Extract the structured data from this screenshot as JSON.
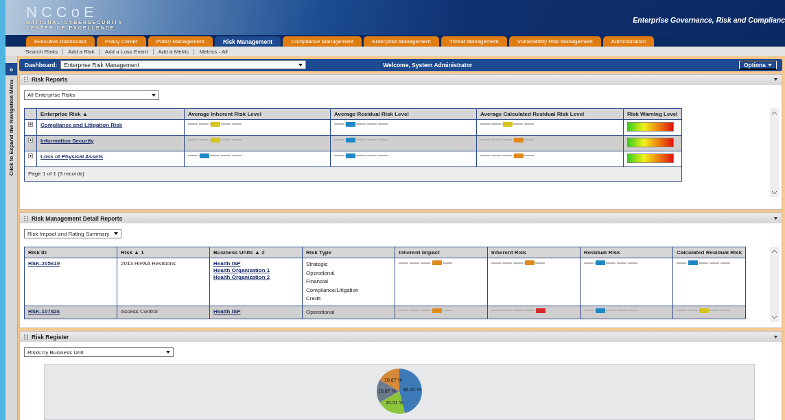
{
  "header": {
    "logo_mark": "NCCoE",
    "logo_line_1": "NATIONAL CYBERSECURITY",
    "logo_line_2": "CENTER OF EXCELLENCE",
    "tagline": "Enterprise Governance, Risk and Complianc"
  },
  "tabs": [
    {
      "label": "Executive Dashboard",
      "selected": false
    },
    {
      "label": "Policy Center",
      "selected": false
    },
    {
      "label": "Policy Management",
      "selected": false
    },
    {
      "label": "Risk Management",
      "selected": true
    },
    {
      "label": "Compliance Management",
      "selected": false
    },
    {
      "label": "Enterprise Management",
      "selected": false
    },
    {
      "label": "Threat Management",
      "selected": false
    },
    {
      "label": "Vulnerability Risk Management",
      "selected": false
    },
    {
      "label": "Administration",
      "selected": false
    }
  ],
  "subnav": [
    "Search Risks",
    "Add a Risk",
    "Add a Loss Event",
    "Add a Metric",
    "Metrics - All"
  ],
  "nav_toggle": {
    "icon": "»",
    "label": "Click to Expand the Navigation Menu"
  },
  "dashboard_bar": {
    "label": "Dashboard:",
    "value": "Enterprise Risk Management",
    "welcome": "Welcome, System Administrator",
    "options": "Options"
  },
  "risk_reports": {
    "title": "Risk Reports",
    "filter": "All Enterprise Risks",
    "columns": [
      "Enterprise Risk ▲",
      "Average Inherent Risk Level",
      "Average Residual Risk Level",
      "Average Calculated Residual Risk Level",
      "Risk Warning Level"
    ],
    "rows": [
      {
        "name": "Compliance and Litigation Risk",
        "levels": [
          {
            "level": 0.5,
            "color": "#d6c41c"
          },
          {
            "level": 0.3,
            "color": "#1f88c4"
          },
          {
            "level": 0.5,
            "color": "#d6c41c"
          }
        ]
      },
      {
        "name": "Information Security",
        "levels": [
          {
            "level": 0.5,
            "color": "#d6c41c"
          },
          {
            "level": 0.3,
            "color": "#1f88c4"
          },
          {
            "level": 0.7,
            "color": "#e08a1a"
          }
        ]
      },
      {
        "name": "Loss of Physical Assets",
        "levels": [
          {
            "level": 0.3,
            "color": "#1f88c4"
          },
          {
            "level": 0.3,
            "color": "#1f88c4"
          },
          {
            "level": 0.7,
            "color": "#e08a1a"
          }
        ]
      }
    ],
    "footer": "Page 1 of 1 (3 records)"
  },
  "detail_reports": {
    "title": "Risk Management Detail Reports",
    "filter": "Risk Impact and Rating Summary",
    "columns": [
      "Risk ID",
      "Risk ▲ 1",
      "Business Units ▲ 2",
      "Risk Type",
      "Inherent Impact",
      "Inherent Risk",
      "Residual Risk",
      "Calculated Residual Risk"
    ],
    "rows": [
      {
        "id": "RSK-205619",
        "risk": "2013 HIPAA Revisions",
        "business_units": [
          "Health ISP",
          "Health Organization 1",
          "Health Organization 2"
        ],
        "risk_types": [
          "Strategic",
          "Operational",
          "Financial",
          "Compliance/Litigation",
          "Credit"
        ],
        "levels": [
          {
            "level": 0.7,
            "color": "#e08a1a"
          },
          {
            "level": 0.7,
            "color": "#e08a1a"
          },
          {
            "level": 0.3,
            "color": "#1f88c4"
          },
          {
            "level": 0.3,
            "color": "#1f88c4"
          }
        ]
      },
      {
        "id": "RSK-107826",
        "risk": "Access Control",
        "business_units": [
          "Health ISP"
        ],
        "risk_types": [
          "Operational"
        ],
        "levels": [
          {
            "level": 0.7,
            "color": "#e08a1a"
          },
          {
            "level": 0.9,
            "color": "#d42a2a"
          },
          {
            "level": 0.3,
            "color": "#1f88c4"
          },
          {
            "level": 0.5,
            "color": "#d6c41c"
          }
        ]
      }
    ]
  },
  "risk_register": {
    "title": "Risks by Business Unit",
    "panel_title": "Risk Register",
    "chart_data": {
      "type": "pie",
      "series": [
        {
          "values": [
            46.15,
            20.51,
            16.67,
            16.67
          ],
          "colors": [
            "#3d7ab8",
            "#8cc43a",
            "#6b7b8c",
            "#d7893a"
          ]
        }
      ],
      "value_labels": [
        "46.15 %",
        "20.51 %",
        "16.67 %",
        "16.67 %"
      ]
    }
  }
}
